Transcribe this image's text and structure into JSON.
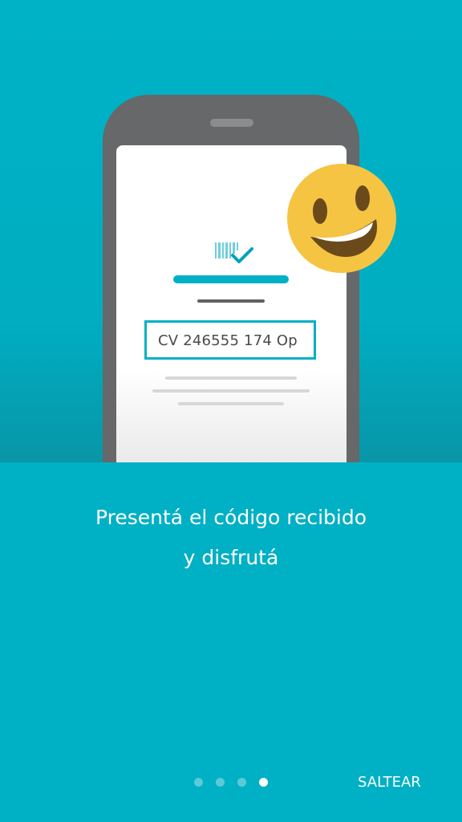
{
  "illustration": {
    "voucher_code": "CV 246555 174 Op",
    "icons": [
      "barcode-check-icon",
      "smiling-emoji-icon"
    ],
    "colors": {
      "accent": "#00b0c4",
      "phone": "#666869",
      "emoji": "#f6c443"
    }
  },
  "caption": {
    "line1": "Presentá el código recibido",
    "line2": "y disfrutá"
  },
  "pager": {
    "total": 4,
    "current": 4
  },
  "skip_label": "SALTEAR"
}
